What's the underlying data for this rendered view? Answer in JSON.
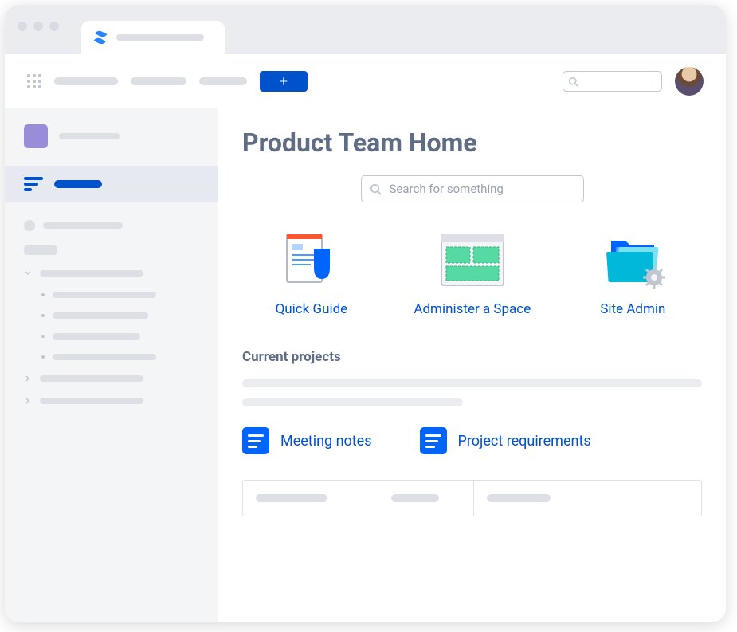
{
  "page": {
    "title": "Product Team Home",
    "search_placeholder": "Search for something"
  },
  "tiles": [
    {
      "label": "Quick Guide"
    },
    {
      "label": "Administer a Space"
    },
    {
      "label": "Site Admin"
    }
  ],
  "sections": {
    "current_projects": "Current projects"
  },
  "links": [
    {
      "label": "Meeting notes"
    },
    {
      "label": "Project requirements"
    }
  ],
  "topnav": {
    "create_label": "+"
  }
}
